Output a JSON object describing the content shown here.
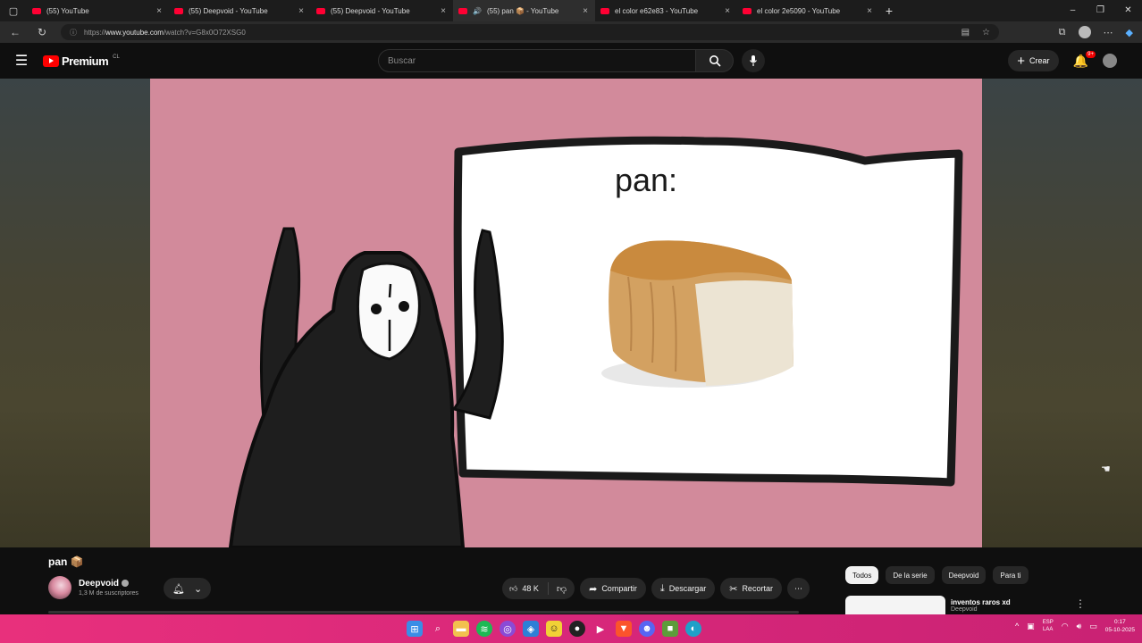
{
  "browser": {
    "tabs": [
      {
        "title": "(55) YouTube",
        "active": false
      },
      {
        "title": "(55) Deepvoid - YouTube",
        "active": false
      },
      {
        "title": "(55) Deepvoid - YouTube",
        "active": false
      },
      {
        "title": "(55) pan 📦 - YouTube",
        "active": true
      },
      {
        "title": "el color e62e83 - YouTube",
        "active": false
      },
      {
        "title": "el color 2e5090 - YouTube",
        "active": false
      }
    ],
    "url_prefix": "https://",
    "url_host": "www.youtube.com",
    "url_path": "/watch?v=G8x0O72XSG0"
  },
  "youtube": {
    "logo_text": "Premium",
    "region": "CL",
    "search_placeholder": "Buscar",
    "create_label": "Crear",
    "notif_count": "9+"
  },
  "video": {
    "sign_text": "pan:",
    "title": "pan 📦",
    "channel": "Deepvoid",
    "subscribers": "1,3 M de suscriptores",
    "likes": "48 K",
    "share_label": "Compartir",
    "download_label": "Descargar",
    "clip_label": "Recortar"
  },
  "sidebar": {
    "chips": [
      "Todos",
      "De la serie",
      "Deepvoid",
      "Para ti"
    ],
    "recommended": {
      "title": "inventos raros xd",
      "channel": "Deepvoid"
    }
  },
  "taskbar": {
    "lang_top": "ESP",
    "lang_bottom": "LAA",
    "time": "0:17",
    "date": "05-10-2025"
  },
  "colors": {
    "page_bg": "#0f0f0f",
    "video_pink": "#d28a9b",
    "yt_red": "#ff0000",
    "taskbar_pink": "#e8307c"
  }
}
